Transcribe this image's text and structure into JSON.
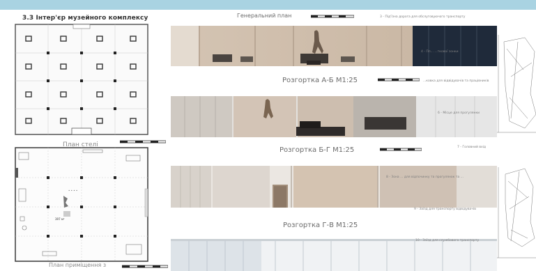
{
  "sheet": {
    "title": "3.3 Інтер'єр музейного комплексу"
  },
  "master_plan": {
    "title": "Генеральний план"
  },
  "ceiling_plan": {
    "caption": "План стелі"
  },
  "floor_plan": {
    "caption": "План приміщення з",
    "area_label": "397 м²",
    "dots_label": "• • • •"
  },
  "elevations": [
    {
      "title": "Розгортка А-Б М1:25"
    },
    {
      "title": "Розгортка Б-Г М1:25"
    },
    {
      "title": "Розгортка Г-В М1:25"
    }
  ],
  "legend": [
    "3 - Під'їзна дорога для обслуговуючого транспорту",
    "4 - Пл... ...ткової зонки",
    "...ковка для відвідувачів та працівників",
    "6 - Місце для прогулянки",
    "7 - Головний вхід",
    "8 - Зона ... для відпочинку та прогулянок та ... ",
    "9 - Заїзд для транспорту відвідувачів",
    "10 - Заїзд для службового транспорту"
  ],
  "colors": {
    "top_band": "#a9d3e2",
    "wall_wood": "#cdbcaa",
    "glass_dark": "#1f2a3a",
    "panel_light": "#e6e6e6"
  }
}
